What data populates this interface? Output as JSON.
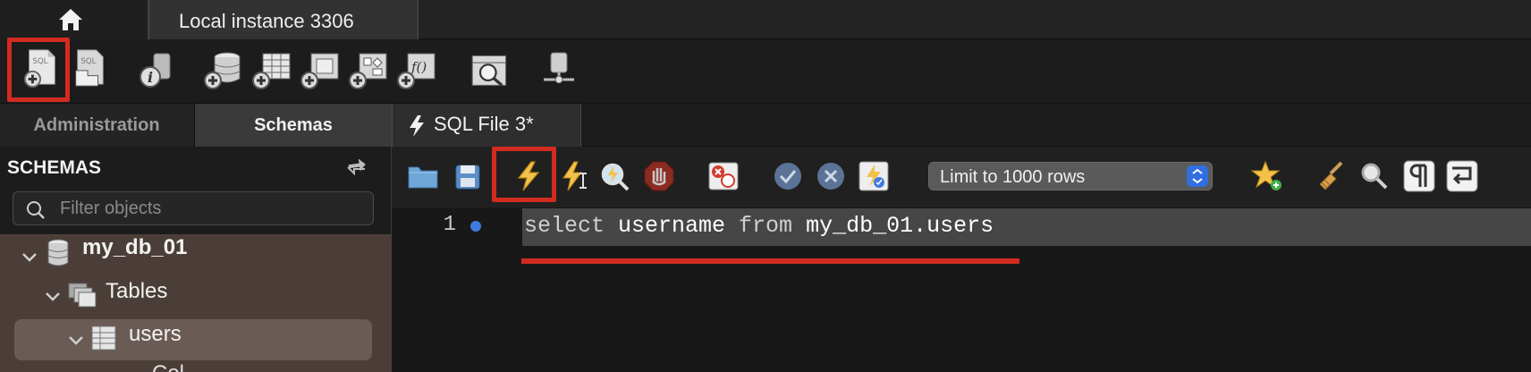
{
  "window": {
    "tabs": [
      {
        "label": "Local instance 3306"
      }
    ]
  },
  "toolbar": {
    "icons": [
      "new-sql-tab-icon",
      "open-sql-script-icon",
      "server-info-icon",
      "create-schema-icon",
      "create-table-icon",
      "create-view-icon",
      "create-procedure-icon",
      "create-function-icon",
      "search-table-data-icon",
      "reconnect-icon"
    ],
    "highlighted": "new-sql-tab-icon",
    "highlight_color": "#d22b20"
  },
  "sidebar": {
    "tabs": [
      {
        "label": "Administration"
      },
      {
        "label": "Schemas"
      }
    ],
    "active_tab": "Schemas",
    "title": "SCHEMAS",
    "filter": {
      "placeholder": "Filter objects",
      "value": ""
    },
    "tree": {
      "schema": "my_db_01",
      "tables_label": "Tables",
      "table": "users",
      "partial_next": "Col"
    }
  },
  "editor": {
    "tab_label": "SQL File 3*",
    "limit_select": "Limit to 1000 rows",
    "line_number": "1",
    "code": {
      "kw_select": "select",
      "col": " username ",
      "kw_from": "from",
      "table": " my_db_01.users"
    }
  }
}
